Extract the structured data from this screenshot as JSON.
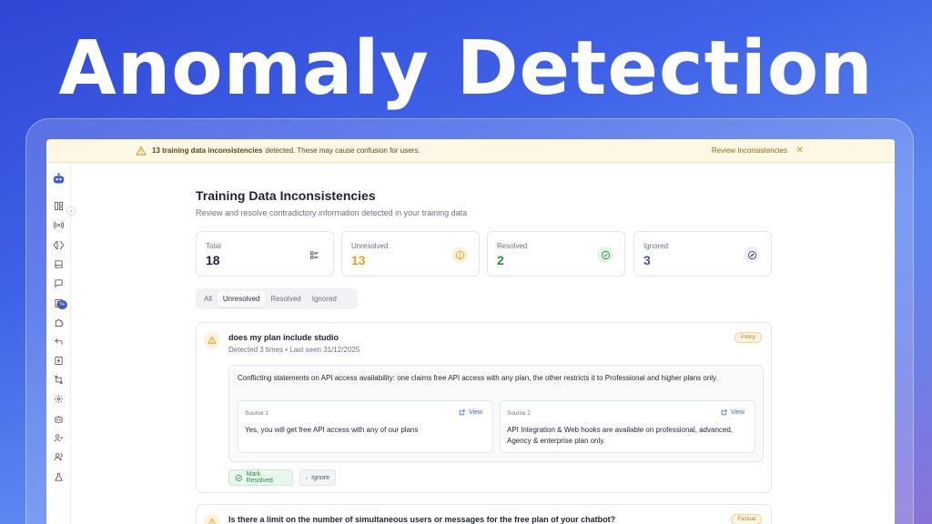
{
  "hero": {
    "title": "Anomaly Detection"
  },
  "banner": {
    "count_text": "13 training data inconsistencies",
    "message": "detected. These may cause confusion for users.",
    "action": "Review Inconsistencies",
    "close": "✕"
  },
  "sidebar": {
    "badge": "9+",
    "icons": [
      "layout-icon",
      "broadcast-icon",
      "brain-icon",
      "book-icon",
      "chat-icon",
      "contacts-icon",
      "puzzle-icon",
      "undo-icon",
      "bolt-doc-icon",
      "flow-icon",
      "gear-icon",
      "bot-icon",
      "user-check-icon",
      "users-icon",
      "flask-icon"
    ]
  },
  "page": {
    "title": "Training Data Inconsistencies",
    "subtitle": "Review and resolve contradictory information detected in your training data"
  },
  "stats": [
    {
      "label": "Total",
      "value": "18",
      "color": "#1f2430"
    },
    {
      "label": "Unresolved",
      "value": "13",
      "color": "#f0a020"
    },
    {
      "label": "Resolved",
      "value": "2",
      "color": "#2f8a45"
    },
    {
      "label": "Ignored",
      "value": "3",
      "color": "#4a5570"
    }
  ],
  "filters": [
    "All",
    "Unresolved",
    "Resolved",
    "Ignored"
  ],
  "issues": [
    {
      "question": "does my plan include studio",
      "meta": "Detected 3 times • Last seen 31/12/2025",
      "tag": "Policy",
      "conflict": "Conflicting statements on API access availability: one claims free API access with any plan, the other restricts it to Professional and higher plans only.",
      "sources": [
        {
          "label": "Source 1",
          "view": "View",
          "text": "Yes, you will get free API access with any of our plans"
        },
        {
          "label": "Source 2",
          "view": "View",
          "text": "API Integration & Web hooks are available on professional, advanced, Agency & enterprise plan only."
        }
      ],
      "actions": {
        "resolve": "Mark Resolved",
        "ignore": "Ignore"
      }
    },
    {
      "question": "Is there a limit on the number of simultaneous users or messages for the free plan of your chatbot?",
      "tag": "Factual"
    }
  ]
}
